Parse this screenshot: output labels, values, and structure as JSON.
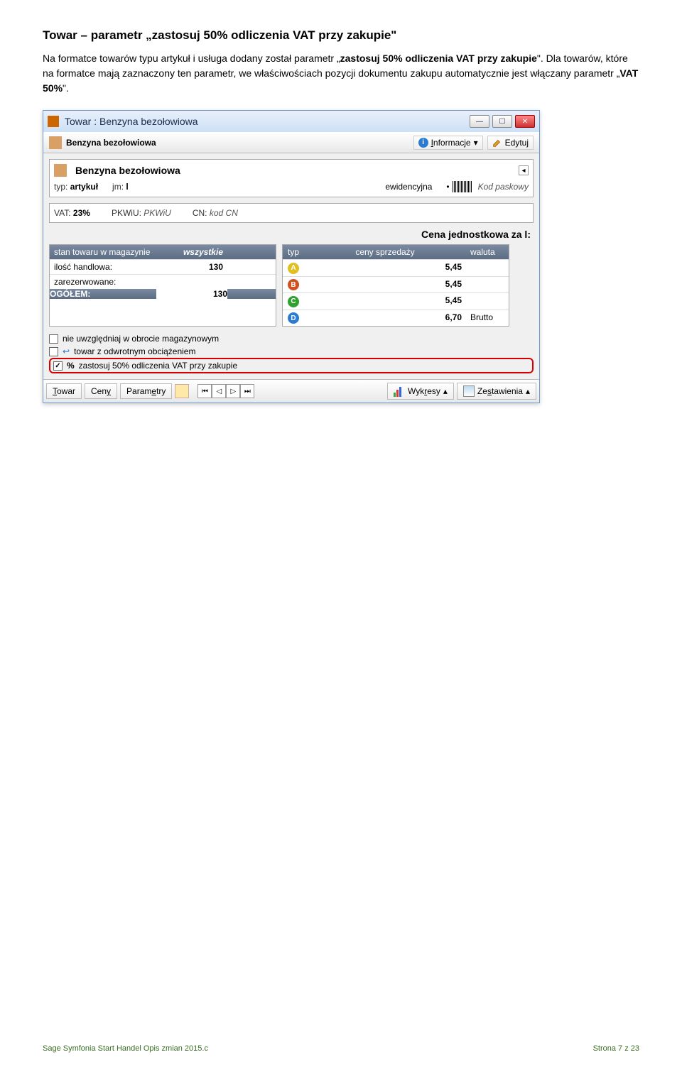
{
  "page": {
    "heading": "Towar – parametr „zastosuj 50% odliczenia VAT przy zakupie\"",
    "paragraph_parts": {
      "p1": "Na formatce towarów typu artykuł i usługa dodany został parametr „",
      "p1b": "zastosuj 50% odliczenia VAT przy zakupie",
      "p1c": "\". Dla towarów, które na formatce mają zaznaczony ten parametr, we właściwościach pozycji dokumentu zakupu automatycznie jest włączany parametr „",
      "p1d": "VAT 50%",
      "p1e": "\"."
    }
  },
  "window": {
    "title": "Towar : Benzyna bezołowiowa",
    "toolbar": {
      "name": "Benzyna bezołowiowa",
      "btn_info": "Informacje",
      "btn_edit": "Edytuj"
    },
    "product_panel": {
      "name": "Benzyna bezołowiowa",
      "typ_label": "typ:",
      "typ_value": "artykuł",
      "jm_label": "jm:",
      "jm_value": "l",
      "ewid": "ewidencyjna",
      "barcode_label": "Kod paskowy"
    },
    "vat_panel": {
      "vat_label": "VAT:",
      "vat_value": "23%",
      "pkwiu_label": "PKWiU:",
      "pkwiu_value": "PKWiU",
      "cn_label": "CN:",
      "cn_value": "kod CN"
    },
    "cena_header": "Cena jednostkowa za l:",
    "mag": {
      "header_stan": "stan towaru w magazynie",
      "header_which": "wszystkie",
      "rows": [
        {
          "label": "ilość handlowa:",
          "value": "130"
        },
        {
          "label": "zarezerwowane:",
          "value": ""
        }
      ],
      "footer_label": "OGÓŁEM:",
      "footer_value": "130"
    },
    "prices": {
      "header_typ": "typ",
      "header_ceny": "ceny sprzedaży",
      "header_waluta": "waluta",
      "rows": [
        {
          "badge": "A",
          "value": "5,45",
          "currency": ""
        },
        {
          "badge": "B",
          "value": "5,45",
          "currency": ""
        },
        {
          "badge": "C",
          "value": "5,45",
          "currency": ""
        },
        {
          "badge": "D",
          "value": "6,70",
          "currency": "Brutto"
        }
      ]
    },
    "checks": {
      "c1": "nie uwzględniaj w obrocie magazynowym",
      "c2": "towar z odwrotnym obciążeniem",
      "c3": "zastosuj 50% odliczenia VAT przy zakupie"
    },
    "bottom": {
      "towar": "Towar",
      "ceny": "Ceny",
      "parametry": "Parametry",
      "wykresy": "Wykresy",
      "zestawienia": "Zestawienia"
    }
  },
  "footer": {
    "left": "Sage Symfonia Start Handel Opis zmian 2015.c",
    "right": "Strona 7 z 23"
  }
}
